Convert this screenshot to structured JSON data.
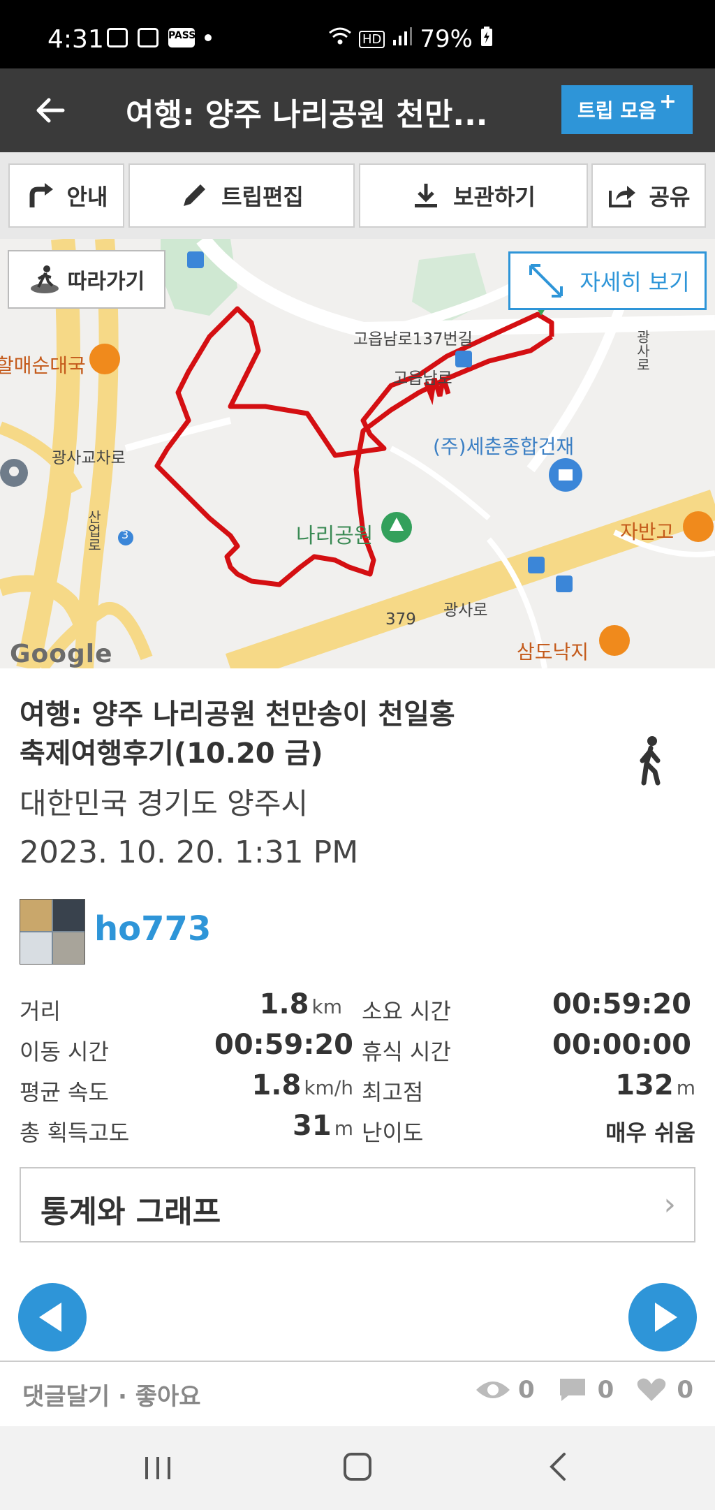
{
  "status_bar": {
    "time": "4:31",
    "notif_pass": "PASS",
    "signal_hd": "HD",
    "battery": "79%"
  },
  "app_bar": {
    "title": "여행: 양주 나리공원 천만...",
    "trip_collection": "트립 모음",
    "plus": "+"
  },
  "toolbar": {
    "guide": "안내",
    "edit": "트립편집",
    "save": "보관하기",
    "share": "공유"
  },
  "map": {
    "follow": "따라가기",
    "detail": "자세히 보기",
    "labels": {
      "road1": "고읍남로137번길",
      "road2": "고읍남로",
      "company": "(주)세춘종합건재",
      "park": "나리공원",
      "store_left": "할매순대국",
      "gwangsa_cross": "광사교차로",
      "jabango": "자반고",
      "samdo": "삼도낙지",
      "gwangsa_ro": "광사로",
      "route_num": "379",
      "route3": "3",
      "vertical": "산업로",
      "right_road": "광사로"
    },
    "google": "Google"
  },
  "trip": {
    "title_line1": "여행: 양주 나리공원 천만송이 천일홍",
    "title_line2": "축제여행후기(10.20 금)",
    "location": "대한민국 경기도 양주시",
    "datetime": "2023. 10. 20. 1:31 PM",
    "user": "ho773"
  },
  "stats": {
    "distance_label": "거리",
    "distance_value": "1.8",
    "distance_unit": "km",
    "duration_label": "소요 시간",
    "duration_value": "00:59:20",
    "moving_label": "이동 시간",
    "moving_value": "00:59:20",
    "rest_label": "휴식 시간",
    "rest_value": "00:00:00",
    "speed_label": "평균 속도",
    "speed_value": "1.8",
    "speed_unit": "km/h",
    "max_alt_label": "최고점",
    "max_alt_value": "132",
    "max_alt_unit": "m",
    "gain_label": "총 획득고도",
    "gain_value": "31",
    "gain_unit": "m",
    "difficulty_label": "난이도",
    "difficulty_value": "매우 쉬움"
  },
  "stats_graph": {
    "label": "통계와 그래프",
    "chevron": "›"
  },
  "comment_bar": {
    "label": "댓글달기 · 좋아요",
    "views": "0",
    "comments": "0",
    "likes": "0"
  },
  "colors": {
    "accent": "#2e95d8",
    "route": "#d40f12",
    "appbar": "#3a3a3a"
  }
}
